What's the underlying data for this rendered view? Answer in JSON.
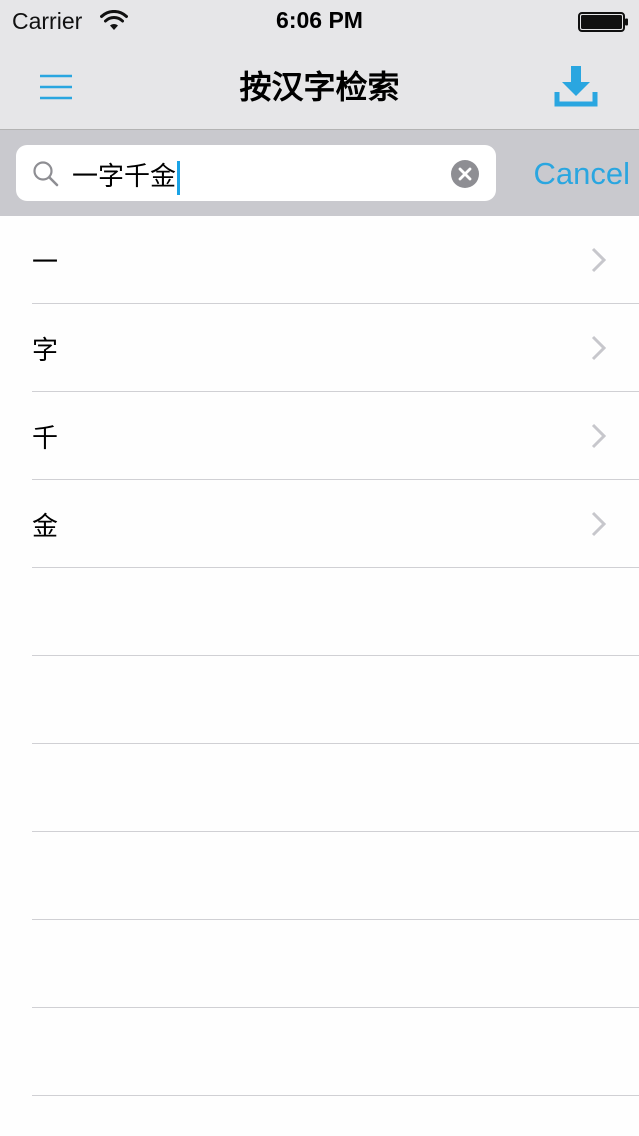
{
  "status_bar": {
    "carrier": "Carrier",
    "time": "6:06 PM"
  },
  "nav_bar": {
    "title": "按汉字检索",
    "left_icon": "menu-icon",
    "right_icon": "download-icon"
  },
  "search": {
    "value": "一字千金",
    "cancel_label": "Cancel"
  },
  "results": [
    {
      "label": "一"
    },
    {
      "label": "字"
    },
    {
      "label": "千"
    },
    {
      "label": "金"
    }
  ],
  "empty_row_count_label": "",
  "colors": {
    "accent": "#2aa6e0",
    "bar_background": "#e6e6e8",
    "search_bar_background": "#c9c9ce",
    "separator": "#d0d0d4",
    "chevron": "#c7c7cc"
  }
}
